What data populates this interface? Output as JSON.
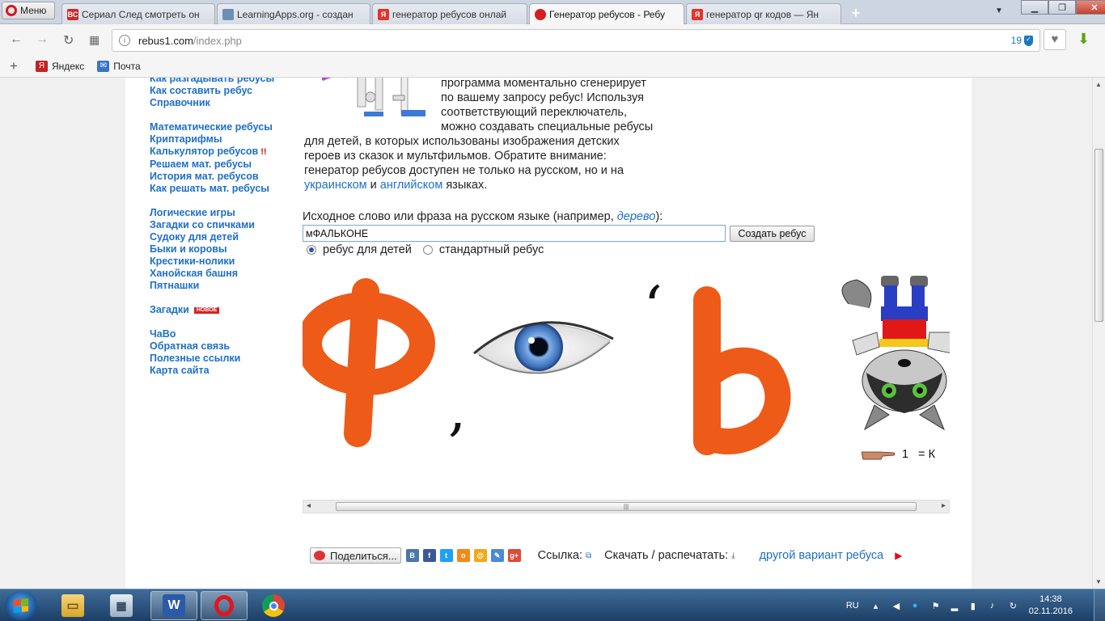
{
  "browser": {
    "menu_label": "Меню",
    "tabs": [
      {
        "title": "Сериал След смотреть он",
        "icon": "vc-icon",
        "icon_text": "ВС",
        "icon_color": "#cc2b2b"
      },
      {
        "title": "LearningApps.org - создан",
        "icon": "learningapps-icon",
        "icon_text": "",
        "icon_color": "#6d8fb5"
      },
      {
        "title": "генератор ребусов онлай",
        "icon": "yandex-icon",
        "icon_text": "Я",
        "icon_color": "#e6332a"
      },
      {
        "title": "Генератор ребусов - Ребу",
        "icon": "rebus-site-icon",
        "icon_text": "",
        "icon_color": "#d42020"
      },
      {
        "title": "генератор qr кодов — Ян",
        "icon": "yandex-icon",
        "icon_text": "Я",
        "icon_color": "#e6332a"
      }
    ],
    "active_tab": 3,
    "url_host": "rebus1.com",
    "url_path": "/index.php",
    "badge_count": "19",
    "bookmarks": [
      {
        "label": "Яндекс",
        "icon": "yandex-bookmark-icon"
      },
      {
        "label": "Почта",
        "icon": "mail-bookmark-icon"
      }
    ]
  },
  "nav": {
    "groups": [
      [
        {
          "label": "Как разгадывать ребусы"
        },
        {
          "label": "Как составить ребус"
        },
        {
          "label": "Справочник"
        }
      ],
      [
        {
          "label": "Математические ребусы"
        },
        {
          "label": "Криптарифмы"
        },
        {
          "label": "Калькулятор ребусов",
          "mark": "!!"
        },
        {
          "label": "Решаем мат. ребусы"
        },
        {
          "label": "История мат. ребусов"
        },
        {
          "label": "Как решать мат. ребусы"
        }
      ],
      [
        {
          "label": "Логические игры"
        },
        {
          "label": "Загадки со спичками"
        },
        {
          "label": "Судоку для детей"
        },
        {
          "label": "Быки и коровы"
        },
        {
          "label": "Крестики-нолики"
        },
        {
          "label": "Ханойская башня"
        },
        {
          "label": "Пятнашки"
        }
      ],
      [
        {
          "label": "Загадки",
          "badge": "НОВОЕ"
        }
      ],
      [
        {
          "label": "ЧаВо"
        },
        {
          "label": "Обратная связь"
        },
        {
          "label": "Полезные ссылки"
        },
        {
          "label": "Карта сайта"
        }
      ]
    ]
  },
  "intro": {
    "line1": "программа моментально сгенерирует",
    "line2": "по вашему запросу ребус! Используя",
    "line3": "соответствующий переключатель,",
    "line4": "можно создавать специальные ребусы",
    "line5": "для детей, в которых использованы изображения детских",
    "line6": "героев из сказок и мультфильмов. Обратите внимание:",
    "line7": "генератор ребусов доступен не только на русском, но и на",
    "link_uk": "украинском",
    "and": "и",
    "link_en": "английском",
    "tail": "языках."
  },
  "form": {
    "label_prefix": "Исходное слово или фраза на русском языке (например, ",
    "label_example": "дерево",
    "label_suffix": "):",
    "input_value": "мФАЛЬКОНЕ",
    "create_button": "Создать ребус",
    "radio_kids": "ребус для детей",
    "radio_standard": "стандартный ребус",
    "selected": "kids"
  },
  "rebus": {
    "letter1": "ф",
    "letter2": "ь",
    "comma": ",",
    "hint_number": "1",
    "hint_text": "= К"
  },
  "share": {
    "share_button": "Поделиться...",
    "link_label": "Ссылка:",
    "download_label": "Скачать / распечатать:",
    "alt_variant": "другой вариант ребуса"
  },
  "taskbar": {
    "lang": "RU",
    "time": "14:38",
    "date": "02.11.2016"
  },
  "colors": {
    "link": "#1d6fc9",
    "plasticine_orange": "#ee5a18"
  }
}
